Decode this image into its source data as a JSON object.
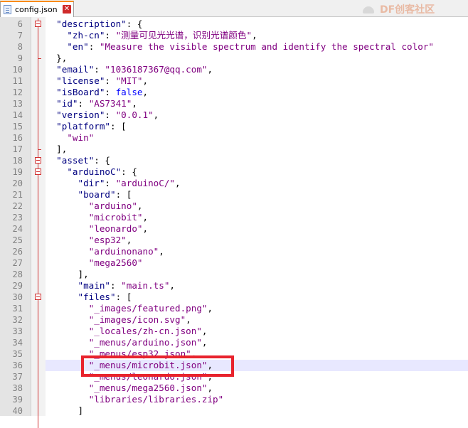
{
  "tab": {
    "filename": "config.json",
    "close_symbol": "✕"
  },
  "watermark": {
    "text": "DF创客社区"
  },
  "colors": {
    "key": "#000080",
    "string": "#800080",
    "boolean": "#0000ff",
    "highlight": "#e8232d",
    "fold_marker": "#d03030"
  },
  "editor": {
    "current_line": 36,
    "highlighted_line": 36,
    "lines": [
      {
        "n": "6",
        "indent": "  ",
        "tokens": [
          {
            "t": "\"description\"",
            "c": "k"
          },
          {
            "t": ": {",
            "c": "p"
          }
        ]
      },
      {
        "n": "7",
        "indent": "    ",
        "tokens": [
          {
            "t": "\"zh-cn\"",
            "c": "k"
          },
          {
            "t": ": ",
            "c": "p"
          },
          {
            "t": "\"测量可见光光谱，识别光谱颜色\"",
            "c": "s"
          },
          {
            "t": ",",
            "c": "p"
          }
        ]
      },
      {
        "n": "8",
        "indent": "    ",
        "tokens": [
          {
            "t": "\"en\"",
            "c": "k"
          },
          {
            "t": ": ",
            "c": "p"
          },
          {
            "t": "\"Measure the visible spectrum and identify the spectral color\"",
            "c": "s"
          }
        ]
      },
      {
        "n": "9",
        "indent": "  ",
        "tokens": [
          {
            "t": "},",
            "c": "p"
          }
        ]
      },
      {
        "n": "10",
        "indent": "  ",
        "tokens": [
          {
            "t": "\"email\"",
            "c": "k"
          },
          {
            "t": ": ",
            "c": "p"
          },
          {
            "t": "\"1036187367@qq.com\"",
            "c": "s"
          },
          {
            "t": ",",
            "c": "p"
          }
        ]
      },
      {
        "n": "11",
        "indent": "  ",
        "tokens": [
          {
            "t": "\"license\"",
            "c": "k"
          },
          {
            "t": ": ",
            "c": "p"
          },
          {
            "t": "\"MIT\"",
            "c": "s"
          },
          {
            "t": ",",
            "c": "p"
          }
        ]
      },
      {
        "n": "12",
        "indent": "  ",
        "tokens": [
          {
            "t": "\"isBoard\"",
            "c": "k"
          },
          {
            "t": ": ",
            "c": "p"
          },
          {
            "t": "false",
            "c": "b"
          },
          {
            "t": ",",
            "c": "p"
          }
        ]
      },
      {
        "n": "13",
        "indent": "  ",
        "tokens": [
          {
            "t": "\"id\"",
            "c": "k"
          },
          {
            "t": ": ",
            "c": "p"
          },
          {
            "t": "\"AS7341\"",
            "c": "s"
          },
          {
            "t": ",",
            "c": "p"
          }
        ]
      },
      {
        "n": "14",
        "indent": "  ",
        "tokens": [
          {
            "t": "\"version\"",
            "c": "k"
          },
          {
            "t": ": ",
            "c": "p"
          },
          {
            "t": "\"0.0.1\"",
            "c": "s"
          },
          {
            "t": ",",
            "c": "p"
          }
        ]
      },
      {
        "n": "15",
        "indent": "  ",
        "tokens": [
          {
            "t": "\"platform\"",
            "c": "k"
          },
          {
            "t": ": [",
            "c": "p"
          }
        ]
      },
      {
        "n": "16",
        "indent": "    ",
        "tokens": [
          {
            "t": "\"win\"",
            "c": "s"
          }
        ]
      },
      {
        "n": "17",
        "indent": "  ",
        "tokens": [
          {
            "t": "],",
            "c": "p"
          }
        ]
      },
      {
        "n": "18",
        "indent": "  ",
        "tokens": [
          {
            "t": "\"asset\"",
            "c": "k"
          },
          {
            "t": ": {",
            "c": "p"
          }
        ]
      },
      {
        "n": "19",
        "indent": "    ",
        "tokens": [
          {
            "t": "\"arduinoC\"",
            "c": "k"
          },
          {
            "t": ": {",
            "c": "p"
          }
        ]
      },
      {
        "n": "20",
        "indent": "      ",
        "tokens": [
          {
            "t": "\"dir\"",
            "c": "k"
          },
          {
            "t": ": ",
            "c": "p"
          },
          {
            "t": "\"arduinoC/\"",
            "c": "s"
          },
          {
            "t": ",",
            "c": "p"
          }
        ]
      },
      {
        "n": "21",
        "indent": "      ",
        "tokens": [
          {
            "t": "\"board\"",
            "c": "k"
          },
          {
            "t": ": [",
            "c": "p"
          }
        ]
      },
      {
        "n": "22",
        "indent": "        ",
        "tokens": [
          {
            "t": "\"arduino\"",
            "c": "s"
          },
          {
            "t": ",",
            "c": "p"
          }
        ]
      },
      {
        "n": "23",
        "indent": "        ",
        "tokens": [
          {
            "t": "\"microbit\"",
            "c": "s"
          },
          {
            "t": ",",
            "c": "p"
          }
        ]
      },
      {
        "n": "24",
        "indent": "        ",
        "tokens": [
          {
            "t": "\"leonardo\"",
            "c": "s"
          },
          {
            "t": ",",
            "c": "p"
          }
        ]
      },
      {
        "n": "25",
        "indent": "        ",
        "tokens": [
          {
            "t": "\"esp32\"",
            "c": "s"
          },
          {
            "t": ",",
            "c": "p"
          }
        ]
      },
      {
        "n": "26",
        "indent": "        ",
        "tokens": [
          {
            "t": "\"arduinonano\"",
            "c": "s"
          },
          {
            "t": ",",
            "c": "p"
          }
        ]
      },
      {
        "n": "27",
        "indent": "        ",
        "tokens": [
          {
            "t": "\"mega2560\"",
            "c": "s"
          }
        ]
      },
      {
        "n": "28",
        "indent": "      ",
        "tokens": [
          {
            "t": "],",
            "c": "p"
          }
        ]
      },
      {
        "n": "29",
        "indent": "      ",
        "tokens": [
          {
            "t": "\"main\"",
            "c": "k"
          },
          {
            "t": ": ",
            "c": "p"
          },
          {
            "t": "\"main.ts\"",
            "c": "s"
          },
          {
            "t": ",",
            "c": "p"
          }
        ]
      },
      {
        "n": "30",
        "indent": "      ",
        "tokens": [
          {
            "t": "\"files\"",
            "c": "k"
          },
          {
            "t": ": [",
            "c": "p"
          }
        ]
      },
      {
        "n": "31",
        "indent": "        ",
        "tokens": [
          {
            "t": "\"_images/featured.png\"",
            "c": "s"
          },
          {
            "t": ",",
            "c": "p"
          }
        ]
      },
      {
        "n": "32",
        "indent": "        ",
        "tokens": [
          {
            "t": "\"_images/icon.svg\"",
            "c": "s"
          },
          {
            "t": ",",
            "c": "p"
          }
        ]
      },
      {
        "n": "33",
        "indent": "        ",
        "tokens": [
          {
            "t": "\"_locales/zh-cn.json\"",
            "c": "s"
          },
          {
            "t": ",",
            "c": "p"
          }
        ]
      },
      {
        "n": "34",
        "indent": "        ",
        "tokens": [
          {
            "t": "\"_menus/arduino.json\"",
            "c": "s"
          },
          {
            "t": ",",
            "c": "p"
          }
        ]
      },
      {
        "n": "35",
        "indent": "        ",
        "tokens": [
          {
            "t": "\"_menus/esp32.json\"",
            "c": "s"
          },
          {
            "t": ",",
            "c": "p"
          }
        ]
      },
      {
        "n": "36",
        "indent": "        ",
        "tokens": [
          {
            "t": "\"_menus/microbit.json\"",
            "c": "s"
          },
          {
            "t": ",",
            "c": "p"
          }
        ]
      },
      {
        "n": "37",
        "indent": "        ",
        "tokens": [
          {
            "t": "\"_menus/leonardo.json\"",
            "c": "s"
          },
          {
            "t": ",",
            "c": "p"
          }
        ]
      },
      {
        "n": "38",
        "indent": "        ",
        "tokens": [
          {
            "t": "\"_menus/mega2560.json\"",
            "c": "s"
          },
          {
            "t": ",",
            "c": "p"
          }
        ]
      },
      {
        "n": "39",
        "indent": "        ",
        "tokens": [
          {
            "t": "\"libraries/libraries.zip\"",
            "c": "s"
          }
        ]
      },
      {
        "n": "40",
        "indent": "      ",
        "tokens": [
          {
            "t": "]",
            "c": "p"
          }
        ]
      }
    ]
  }
}
